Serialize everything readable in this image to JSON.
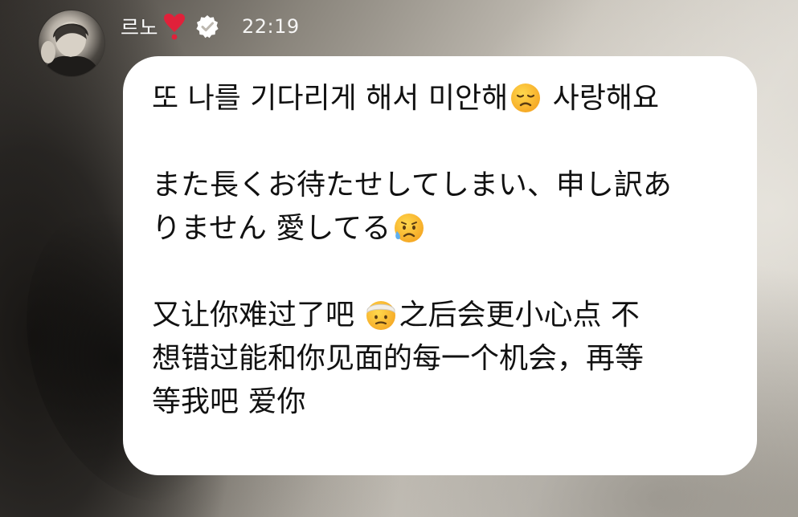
{
  "header": {
    "name": "르노",
    "time": "22:19",
    "icons": [
      "heart-exclamation-icon",
      "verified-badge-icon"
    ]
  },
  "message": {
    "korean_text": "또 나를 기다리게 해서 미안해",
    "korean_tail": " 사랑해요",
    "korean_emoji": "disappointed-face-emoji",
    "japanese_line1": "また長くお待たせしてしまい、申し訳あ",
    "japanese_line2": "りません 愛してる",
    "japanese_emoji": "anxious-face-with-sweat-emoji",
    "chinese_lead": "又让你难过了吧 ",
    "chinese_emoji": "face-with-head-bandage-emoji",
    "chinese_rest1": "之后会更小心点 不",
    "chinese_line2": "想错过能和你见面的每一个机会，再等",
    "chinese_line3": "等我吧 爱你"
  },
  "colors": {
    "bubble": "#ffffff",
    "text": "#111111",
    "heart": "#e0213a",
    "header_text": "#ffffff"
  }
}
